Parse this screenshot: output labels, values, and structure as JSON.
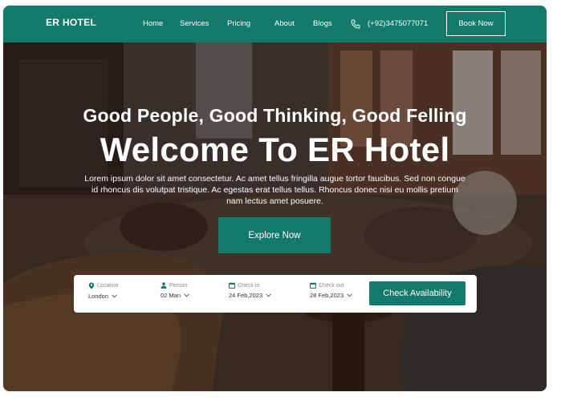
{
  "navbar": {
    "brand": "ER HOTEL",
    "links": [
      "Home",
      "Services",
      "Pricing",
      "About",
      "Blogs"
    ],
    "phone": "(+92)3475077071",
    "book_label": "Book Now"
  },
  "hero": {
    "tagline": "Good People, Good Thinking, Good Felling",
    "headline": "Welcome To ER Hotel",
    "paragraph": "Lorem ipsum dolor sit amet consectetur. Ac amet tellus fringilla augue tortor faucibus. Sed non congue id rhoncus dis volutpat tristique. Ac egestas erat tellus tellus. Rhoncus donec nisi eu mollis pretium nam lectus amet posuere.",
    "explore_label": "Explore Now"
  },
  "booking": {
    "location": {
      "label": "Location",
      "value": "London"
    },
    "person": {
      "label": "Person",
      "value": "02 Man"
    },
    "check_in": {
      "label": "Check in",
      "value": "24 Feb,2023"
    },
    "check_out": {
      "label": "Check out",
      "value": "28 Feb,2023"
    },
    "button_label": "Check Availability"
  },
  "colors": {
    "brand": "#137a6b",
    "white": "#ffffff"
  },
  "icons": [
    "phone-icon",
    "location-pin-icon",
    "person-icon",
    "calendar-icon",
    "chevron-down-icon"
  ]
}
